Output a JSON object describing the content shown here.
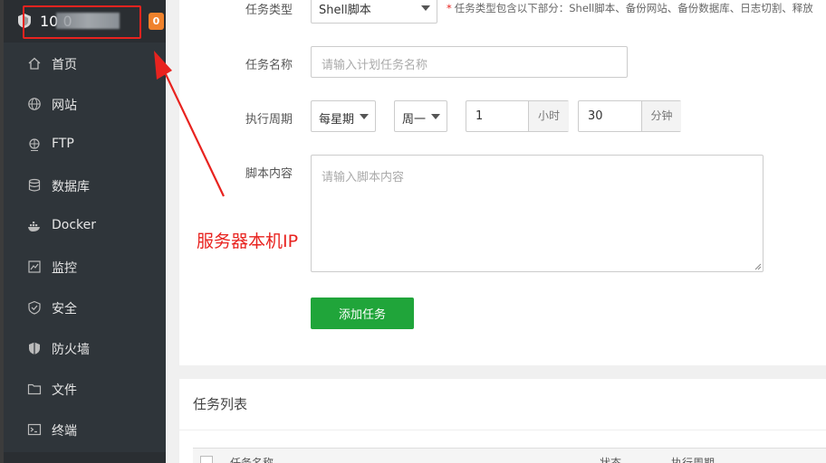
{
  "sidebar": {
    "host_ip": "10               0",
    "message_count": "0",
    "items": [
      {
        "label": "首页",
        "icon": "home-icon"
      },
      {
        "label": "网站",
        "icon": "globe-icon"
      },
      {
        "label": "FTP",
        "icon": "ftp-globe-icon"
      },
      {
        "label": "数据库",
        "icon": "database-icon"
      },
      {
        "label": "Docker",
        "icon": "docker-icon"
      },
      {
        "label": "监控",
        "icon": "monitor-chart-icon"
      },
      {
        "label": "安全",
        "icon": "shield-check-icon"
      },
      {
        "label": "防火墙",
        "icon": "firewall-shield-icon"
      },
      {
        "label": "文件",
        "icon": "folder-icon"
      },
      {
        "label": "终端",
        "icon": "terminal-icon"
      }
    ]
  },
  "form": {
    "task_type_label": "任务类型",
    "task_type_value": "Shell脚本",
    "task_type_hint": "任务类型包含以下部分：Shell脚本、备份网站、备份数据库、日志切割、释放",
    "task_name_label": "任务名称",
    "task_name_placeholder": "请输入计划任务名称",
    "cycle_label": "执行周期",
    "cycle_type": "每星期",
    "cycle_weekday": "周一",
    "hour_value": "1",
    "hour_unit": "小时",
    "minute_value": "30",
    "minute_unit": "分钟",
    "script_label": "脚本内容",
    "script_placeholder": "请输入脚本内容",
    "submit_label": "添加任务"
  },
  "annotation": {
    "text": "服务器本机IP",
    "color": "#e8231f"
  },
  "task_list": {
    "title": "任务列表",
    "columns": [
      "任务名称",
      "状态",
      "执行周期"
    ]
  },
  "colors": {
    "sidebar_bg": "#2f353a",
    "accent_green": "#20a53a",
    "badge_orange": "#f0822c",
    "annotation_red": "#e8231f"
  }
}
